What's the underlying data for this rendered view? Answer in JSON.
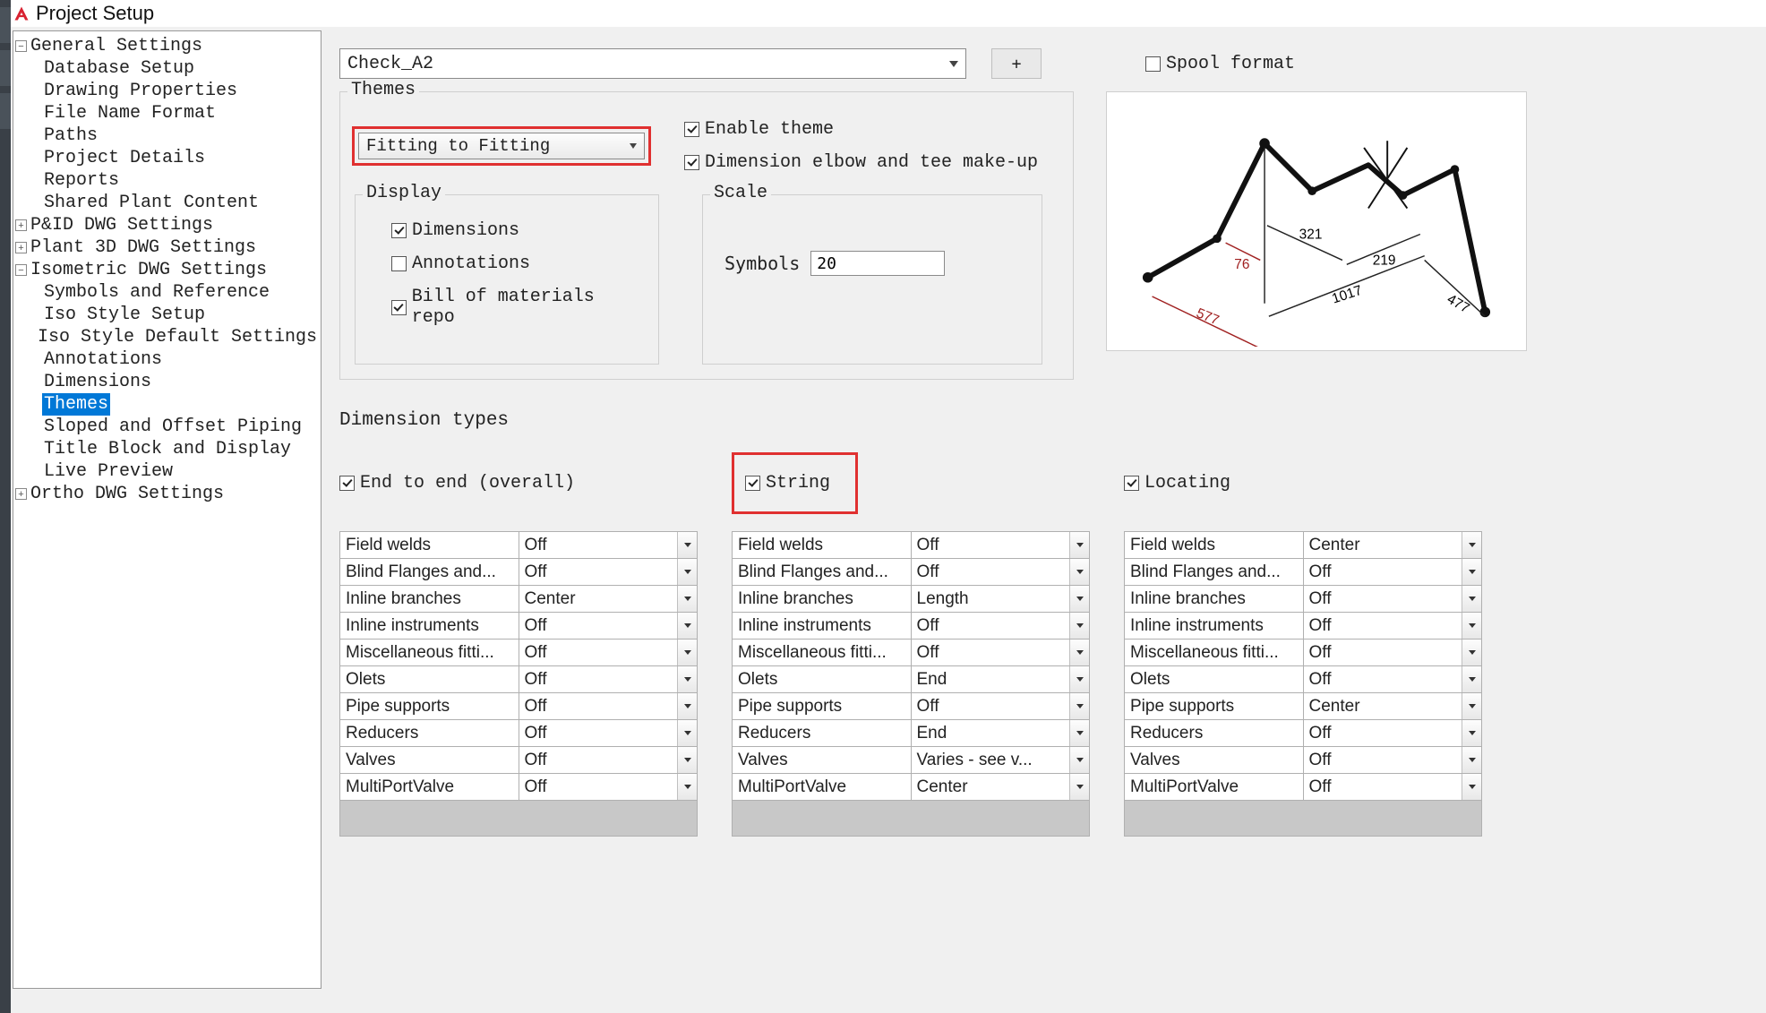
{
  "window": {
    "title": "Project Setup"
  },
  "tree": {
    "general": {
      "label": "General Settings",
      "children": {
        "database": "Database Setup",
        "drawing_props": "Drawing Properties",
        "file_name": "File Name Format",
        "paths": "Paths",
        "project_details": "Project Details",
        "reports": "Reports",
        "shared": "Shared Plant Content"
      }
    },
    "pid": {
      "label": "P&ID DWG Settings"
    },
    "plant3d": {
      "label": "Plant 3D DWG Settings"
    },
    "iso": {
      "label": "Isometric DWG Settings",
      "children": {
        "symbols": "Symbols and Reference",
        "iso_style": "Iso Style Setup",
        "iso_style_def": "Iso Style Default Settings",
        "annotations": "Annotations",
        "dimensions": "Dimensions",
        "themes": "Themes",
        "sloped": "Sloped and Offset Piping",
        "titleblock": "Title Block and Display",
        "live_preview": "Live Preview"
      }
    },
    "ortho": {
      "label": "Ortho DWG Settings"
    }
  },
  "toolbar": {
    "style_combo": "Check_A2",
    "plus": "+",
    "spool_format": "Spool format"
  },
  "themes_section": {
    "legend": "Themes",
    "theme_combo": "Fitting to Fitting",
    "enable": "Enable theme",
    "dim_elbow": "Dimension elbow and tee make-up"
  },
  "display_section": {
    "legend": "Display",
    "dimensions": "Dimensions",
    "annotations": "Annotations",
    "bom": "Bill of materials repo"
  },
  "scale_section": {
    "legend": "Scale",
    "symbols_label": "Symbols",
    "symbols_value": "20"
  },
  "dim_types": {
    "legend": "Dimension types",
    "columns": [
      {
        "key": "end_to_end",
        "label": "End to end (overall)",
        "checked": true,
        "rows": [
          {
            "name": "Field welds",
            "value": "Off"
          },
          {
            "name": "Blind Flanges and...",
            "value": "Off"
          },
          {
            "name": "Inline branches",
            "value": "Center"
          },
          {
            "name": "Inline instruments",
            "value": "Off"
          },
          {
            "name": "Miscellaneous fitti...",
            "value": "Off"
          },
          {
            "name": "Olets",
            "value": "Off"
          },
          {
            "name": "Pipe supports",
            "value": "Off"
          },
          {
            "name": "Reducers",
            "value": "Off"
          },
          {
            "name": "Valves",
            "value": "Off"
          },
          {
            "name": "MultiPortValve",
            "value": "Off"
          }
        ]
      },
      {
        "key": "string",
        "label": "String",
        "checked": true,
        "highlighted": true,
        "rows": [
          {
            "name": "Field welds",
            "value": "Off"
          },
          {
            "name": "Blind Flanges and...",
            "value": "Off"
          },
          {
            "name": "Inline branches",
            "value": "Length"
          },
          {
            "name": "Inline instruments",
            "value": "Off"
          },
          {
            "name": "Miscellaneous fitti...",
            "value": "Off"
          },
          {
            "name": "Olets",
            "value": "End"
          },
          {
            "name": "Pipe supports",
            "value": "Off"
          },
          {
            "name": "Reducers",
            "value": "End"
          },
          {
            "name": "Valves",
            "value": "Varies - see v..."
          },
          {
            "name": "MultiPortValve",
            "value": "Center"
          }
        ]
      },
      {
        "key": "locating",
        "label": "Locating",
        "checked": true,
        "rows": [
          {
            "name": "Field welds",
            "value": "Center"
          },
          {
            "name": "Blind Flanges and...",
            "value": "Off"
          },
          {
            "name": "Inline branches",
            "value": "Off"
          },
          {
            "name": "Inline instruments",
            "value": "Off"
          },
          {
            "name": "Miscellaneous fitti...",
            "value": "Off"
          },
          {
            "name": "Olets",
            "value": "Off"
          },
          {
            "name": "Pipe supports",
            "value": "Center"
          },
          {
            "name": "Reducers",
            "value": "Off"
          },
          {
            "name": "Valves",
            "value": "Off"
          },
          {
            "name": "MultiPortValve",
            "value": "Off"
          }
        ]
      }
    ]
  },
  "preview": {
    "labels": {
      "a": "76",
      "b": "321",
      "c": "577",
      "d": "219",
      "e": "1017",
      "f": "477"
    }
  }
}
